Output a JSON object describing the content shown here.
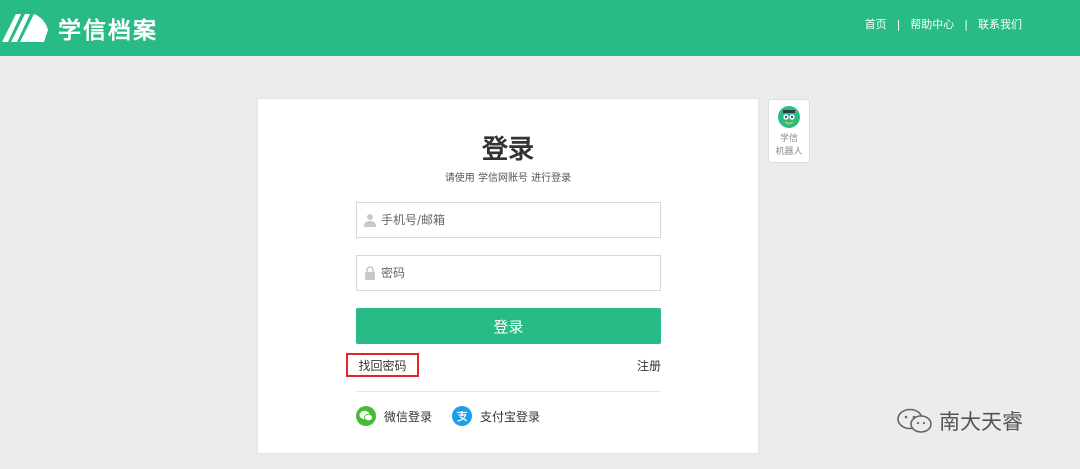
{
  "brand": {
    "name": "学信档案",
    "logo_icon": "book-logo-icon"
  },
  "topnav": {
    "items": [
      {
        "label": "首页"
      },
      {
        "label": "帮助中心"
      },
      {
        "label": "联系我们"
      }
    ],
    "separator": "|"
  },
  "login": {
    "title": "登录",
    "subtitle": "请使用 学信网账号 进行登录",
    "username": {
      "placeholder": "手机号/邮箱",
      "value": "",
      "icon": "user-icon"
    },
    "password": {
      "placeholder": "密码",
      "value": "",
      "icon": "lock-icon"
    },
    "submit_label": "登录",
    "forgot_label": "找回密码",
    "register_label": "注册",
    "highlight_color": "#e0262a",
    "social": [
      {
        "label": "微信登录",
        "icon": "wechat-icon",
        "color": "#46bb36"
      },
      {
        "label": "支付宝登录",
        "icon": "alipay-icon",
        "color": "#1aa0e6"
      }
    ]
  },
  "robot": {
    "line1": "学信",
    "line2": "机器人",
    "icon": "robot-avatar-icon"
  },
  "watermark": {
    "text": "南大天睿",
    "icon": "wechat-outline-icon"
  },
  "colors": {
    "accent": "#28bb86",
    "background": "#ececec"
  }
}
